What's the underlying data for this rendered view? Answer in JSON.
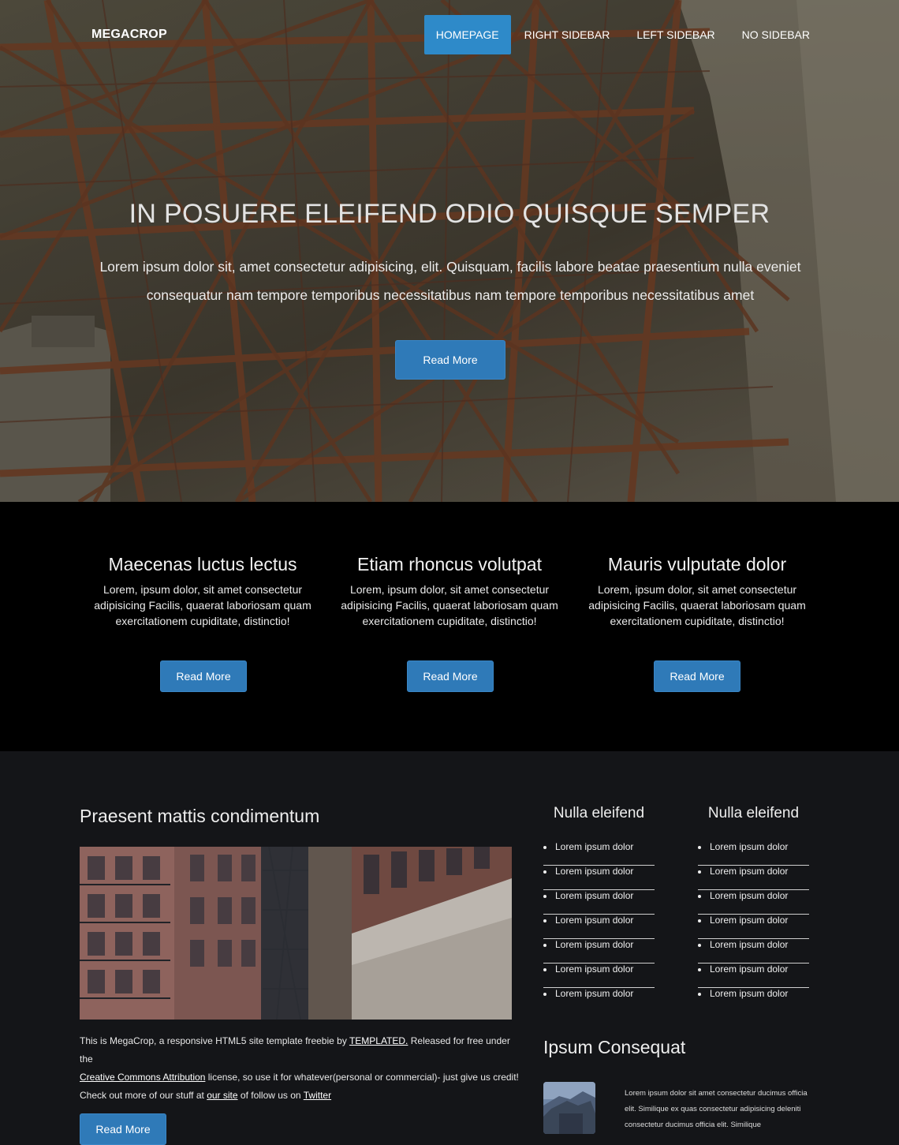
{
  "brand": "MEGACROP",
  "nav": {
    "items": [
      {
        "label": "HOMEPAGE",
        "active": true
      },
      {
        "label": "RIGHT SIDEBAR",
        "active": false
      },
      {
        "label": "LEFT SIDEBAR",
        "active": false
      },
      {
        "label": "NO SIDEBAR",
        "active": false
      }
    ]
  },
  "hero": {
    "title": "IN POSUERE ELEIFEND ODIO QUISQUE SEMPER",
    "text": "Lorem ipsum dolor sit, amet consectetur adipisicing, elit. Quisquam, facilis labore beatae praesentium nulla eveniet consequatur nam tempore temporibus necessitatibus nam tempore temporibus necessitatibus amet",
    "button": "Read More"
  },
  "features": [
    {
      "title": "Maecenas luctus lectus",
      "text": "Lorem, ipsum dolor, sit amet consectetur adipisicing Facilis, quaerat laboriosam quam exercitationem cupiditate, distinctio!",
      "button": "Read More"
    },
    {
      "title": "Etiam rhoncus volutpat",
      "text": "Lorem, ipsum dolor, sit amet consectetur adipisicing Facilis, quaerat laboriosam quam exercitationem cupiditate, distinctio!",
      "button": "Read More"
    },
    {
      "title": "Mauris vulputate dolor",
      "text": "Lorem, ipsum dolor, sit amet consectetur adipisicing Facilis, quaerat laboriosam quam exercitationem cupiditate, distinctio!",
      "button": "Read More"
    }
  ],
  "post": {
    "title": "Praesent mattis condimentum",
    "text_1": "This is MegaCrop, a responsive HTML5 site template freebie by ",
    "link_templated": "TEMPLATED.",
    "text_2": " Released for free under the ",
    "link_cc": "Creative Commons Attribution",
    "text_3": " license, so use it for whatever(personal or commercial)- just give us credit! Check out more of our stuff at ",
    "link_site": "our site",
    "text_4": " of follow us on ",
    "link_twitter": "Twitter",
    "button": "Read More"
  },
  "sidebar": {
    "col1": {
      "title": "Nulla eleifend",
      "items": [
        "Lorem ipsum dolor",
        "Lorem ipsum dolor",
        "Lorem ipsum dolor",
        "Lorem ipsum dolor",
        "Lorem ipsum dolor",
        "Lorem ipsum dolor",
        "Lorem ipsum dolor"
      ]
    },
    "col2": {
      "title": "Nulla eleifend",
      "items": [
        "Lorem ipsum dolor",
        "Lorem ipsum dolor",
        "Lorem ipsum dolor",
        "Lorem ipsum dolor",
        "Lorem ipsum dolor",
        "Lorem ipsum dolor",
        "Lorem ipsum dolor"
      ]
    },
    "ipsum_title": "Ipsum Consequat",
    "ipsum_text": "Lorem ipsum dolor sit amet consectetur ducimus officia elit. Similique ex quas consectetur adipisicing deleniti consectetur ducimus officia elit. Similique"
  },
  "colors": {
    "accent": "#2e8ac9",
    "button": "#2f7ab8",
    "features_bg": "#000000",
    "main_bg": "#141518"
  }
}
